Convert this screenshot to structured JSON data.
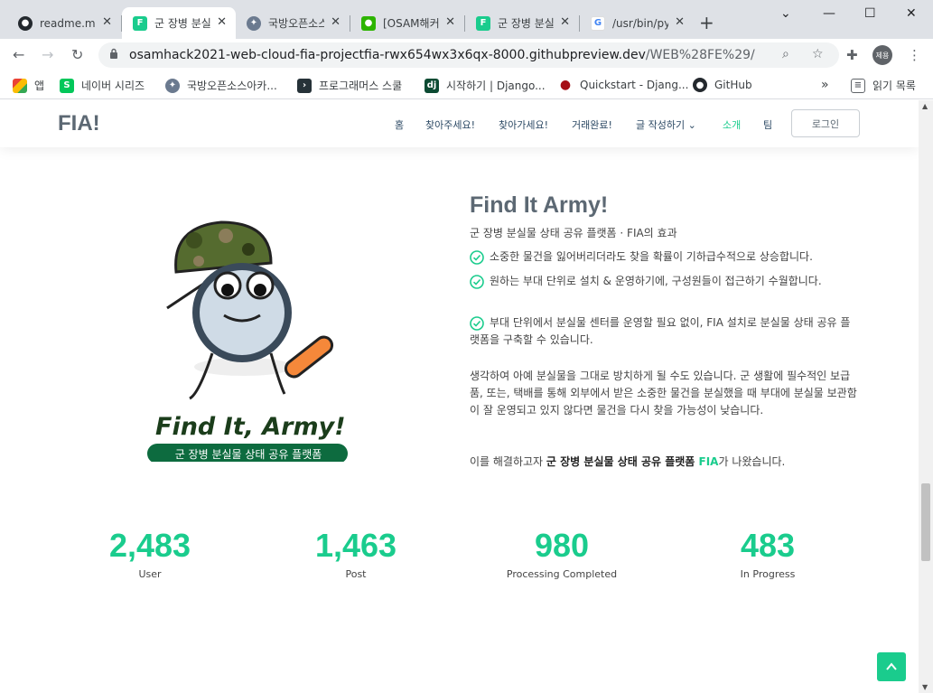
{
  "browser": {
    "tabs": [
      {
        "label": "readme.md",
        "icon": "github-icon"
      },
      {
        "label": "군 장병 분실물",
        "icon": "fia-icon",
        "active": true
      },
      {
        "label": "국방오픈소스",
        "icon": "osam-icon"
      },
      {
        "label": "[OSAM해커톤]",
        "icon": "kakao-icon"
      },
      {
        "label": "군 장병 분실물",
        "icon": "fia-icon"
      },
      {
        "label": "/usr/bin/python",
        "icon": "google-icon"
      }
    ],
    "url_host": "osamhack2021-web-cloud-fia-projectfia-rwx654wx3x6qx-8000.githubpreview.dev",
    "url_path": "/WEB%28FE%29/",
    "avatar_text": "제용",
    "bookmarks": [
      {
        "label": "앱",
        "icon": "apps-icon"
      },
      {
        "label": "네이버 시리즈",
        "icon": "naver-series-icon"
      },
      {
        "label": "국방오픈소스아카...",
        "icon": "osam-icon"
      },
      {
        "label": "프로그래머스 스쿨",
        "icon": "programmers-icon"
      },
      {
        "label": "시작하기 | Django...",
        "icon": "django-icon"
      },
      {
        "label": "Quickstart - Djang...",
        "icon": "pin-icon"
      },
      {
        "label": "GitHub",
        "icon": "github-icon"
      }
    ],
    "bookmarks_overflow": "»",
    "reading_list": "읽기 목록"
  },
  "site": {
    "logo": "FIA!",
    "menu": [
      "홈",
      "찾아주세요!",
      "찾아가세요!",
      "거래완료!",
      "글 작성하기",
      "소개",
      "팀"
    ],
    "login": "로그인"
  },
  "about": {
    "title": "Find It Army!",
    "subtitle": "군 장병 분실물 상태 공유 플랫폼 · FIA의 효과",
    "checks": [
      "소중한 물건을 잃어버리더라도 찾을 확률이 기하급수적으로 상승합니다.",
      "원하는 부대 단위로 설치 & 운영하기에, 구성원들이 접근하기 수월합니다.",
      "부대 단위에서 분실물 센터를 운영할 필요 없이, FIA 설치로 분실물 상태 공유 플랫폼을 구축할 수 있습니다."
    ],
    "para1": "생각하여 아예 분실물을 그대로 방치하게 될 수도 있습니다. 군 생활에 필수적인 보급품, 또는, 택배를 통해 외부에서 받은 소중한 물건을 분실했을 때 부대에 분실물 보관함이 잘 운영되고 있지 않다면 물건을 다시 찾을 가능성이 낮습니다.",
    "para2_pre": "이를 해결하고자 ",
    "para2_bold": "군 장병 분실물 상태 공유 플랫폼 ",
    "para2_accent": "FIA",
    "para2_post": "가 나왔습니다."
  },
  "mascot": {
    "text_main": "Find It, Army!",
    "text_banner": "군 장병 분실물 상태 공유 플랫폼"
  },
  "stats": [
    {
      "value": "2,483",
      "label": "User"
    },
    {
      "value": "1,463",
      "label": "Post"
    },
    {
      "value": "980",
      "label": "Processing Completed"
    },
    {
      "value": "483",
      "label": "In Progress"
    }
  ],
  "colors": {
    "accent": "#1acc8d",
    "logo": "#5c6873"
  }
}
